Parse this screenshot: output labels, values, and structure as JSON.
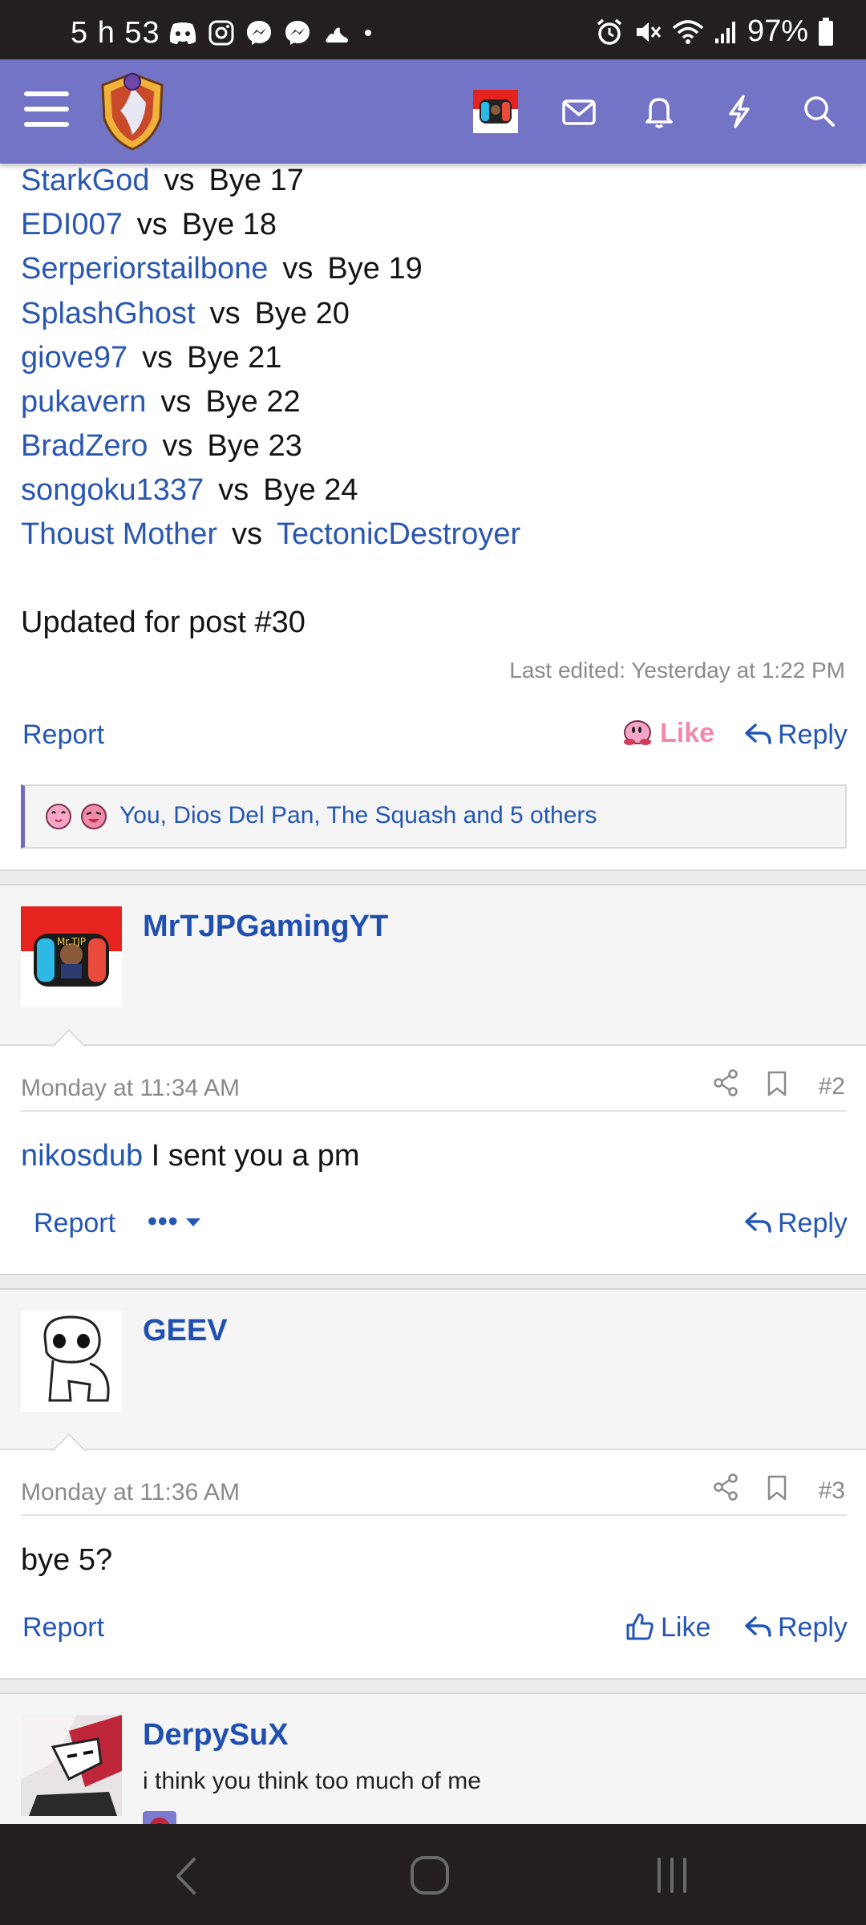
{
  "status_bar": {
    "time": "5 h 53",
    "battery": "97%",
    "left_icons": [
      "discord-icon",
      "instagram-icon",
      "messenger-icon",
      "messenger-icon",
      "samsung-health-icon",
      "dot-icon"
    ],
    "right_icons": [
      "alarm-icon",
      "mute-icon",
      "wifi-icon",
      "signal-icon",
      "battery-icon"
    ]
  },
  "header": {
    "icons": [
      "menu-icon",
      "site-logo",
      "user-avatar",
      "inbox-icon",
      "alerts-icon",
      "whats-new-icon",
      "search-icon"
    ],
    "background": "#7474c7"
  },
  "matches": [
    {
      "player": "StarkGod",
      "vs": "vs",
      "opponent": "Bye 17",
      "opponent_is_user": false
    },
    {
      "player": "EDI007",
      "vs": "vs",
      "opponent": "Bye 18",
      "opponent_is_user": false
    },
    {
      "player": "Serperiorstailbone",
      "vs": "vs",
      "opponent": "Bye 19",
      "opponent_is_user": false
    },
    {
      "player": "SplashGhost",
      "vs": "vs",
      "opponent": "Bye 20",
      "opponent_is_user": false
    },
    {
      "player": "giove97",
      "vs": "vs",
      "opponent": "Bye 21",
      "opponent_is_user": false
    },
    {
      "player": "pukavern",
      "vs": "vs",
      "opponent": "Bye 22",
      "opponent_is_user": false
    },
    {
      "player": "BradZero",
      "vs": "vs",
      "opponent": "Bye 23",
      "opponent_is_user": false
    },
    {
      "player": "songoku1337",
      "vs": "vs",
      "opponent": "Bye 24",
      "opponent_is_user": false
    },
    {
      "player": "Thoust Mother",
      "vs": "vs",
      "opponent": "TectonicDestroyer",
      "opponent_is_user": true
    }
  ],
  "first_post": {
    "updated_note": "Updated for post #30",
    "last_edited": "Last edited: Yesterday at 1:22 PM",
    "report": "Report",
    "like": "Like",
    "reply": "Reply",
    "reactions_text": "You, Dios Del Pan, The Squash and 5 others"
  },
  "posts": [
    {
      "username": "MrTJPGamingYT",
      "date": "Monday at 11:34 AM",
      "number": "#2",
      "mention": "nikosdub",
      "body": " I sent you a pm",
      "report": "Report",
      "more": "•••",
      "reply": "Reply"
    },
    {
      "username": "GEEV",
      "date": "Monday at 11:36 AM",
      "number": "#3",
      "body": "bye 5?",
      "report": "Report",
      "like": "Like",
      "reply": "Reply"
    },
    {
      "username": "DerpySuX",
      "user_title": "i think you think too much of me"
    }
  ],
  "colors": {
    "link": "#2456b3",
    "username": "#1f4fb0",
    "like_active": "#f08aac",
    "status_bar": "#231f20"
  },
  "nav_bar": [
    "back-icon",
    "home-icon",
    "recents-icon"
  ]
}
